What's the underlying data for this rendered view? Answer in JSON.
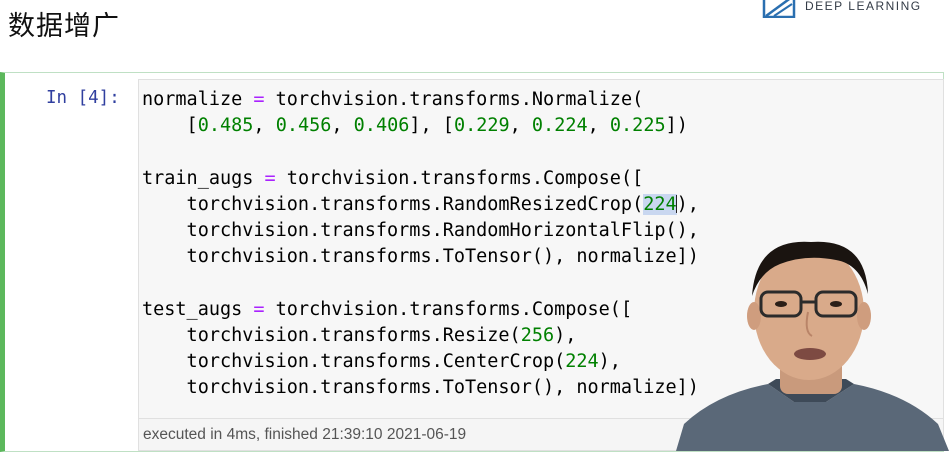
{
  "page": {
    "title": "数据增广",
    "brand": {
      "text": "DEEP LEARNING",
      "icon": "book-logo-icon"
    }
  },
  "cell": {
    "prompt": "In [4]:",
    "lines": [
      [
        {
          "t": "normalize ",
          "c": "plain"
        },
        {
          "t": "=",
          "c": "op"
        },
        {
          "t": " torchvision.transforms.Normalize(",
          "c": "plain"
        }
      ],
      [
        {
          "t": "    [",
          "c": "plain"
        },
        {
          "t": "0.485",
          "c": "num"
        },
        {
          "t": ", ",
          "c": "plain"
        },
        {
          "t": "0.456",
          "c": "num"
        },
        {
          "t": ", ",
          "c": "plain"
        },
        {
          "t": "0.406",
          "c": "num"
        },
        {
          "t": "], [",
          "c": "plain"
        },
        {
          "t": "0.229",
          "c": "num"
        },
        {
          "t": ", ",
          "c": "plain"
        },
        {
          "t": "0.224",
          "c": "num"
        },
        {
          "t": ", ",
          "c": "plain"
        },
        {
          "t": "0.225",
          "c": "num"
        },
        {
          "t": "])",
          "c": "plain"
        }
      ],
      [],
      [
        {
          "t": "train_augs ",
          "c": "plain"
        },
        {
          "t": "=",
          "c": "op"
        },
        {
          "t": " torchvision.transforms.Compose([",
          "c": "plain"
        }
      ],
      [
        {
          "t": "    torchvision.transforms.RandomResizedCrop(",
          "c": "plain"
        },
        {
          "t": "224",
          "c": "num",
          "selected": true
        },
        {
          "t": "),",
          "c": "plain"
        }
      ],
      [
        {
          "t": "    torchvision.transforms.RandomHorizontalFlip(),",
          "c": "plain"
        }
      ],
      [
        {
          "t": "    torchvision.transforms.ToTensor(), normalize])",
          "c": "plain"
        }
      ],
      [],
      [
        {
          "t": "test_augs ",
          "c": "plain"
        },
        {
          "t": "=",
          "c": "op"
        },
        {
          "t": " torchvision.transforms.Compose([",
          "c": "plain"
        }
      ],
      [
        {
          "t": "    torchvision.transforms.Resize(",
          "c": "plain"
        },
        {
          "t": "256",
          "c": "num"
        },
        {
          "t": "),",
          "c": "plain"
        }
      ],
      [
        {
          "t": "    torchvision.transforms.CenterCrop(",
          "c": "plain"
        },
        {
          "t": "224",
          "c": "num"
        },
        {
          "t": "),",
          "c": "plain"
        }
      ],
      [
        {
          "t": "    torchvision.transforms.ToTensor(), normalize])",
          "c": "plain"
        }
      ]
    ],
    "execution_info": "executed in 4ms, finished 21:39:10 2021-06-19"
  },
  "colors": {
    "operator": "#aa22ff",
    "number": "#008000",
    "prompt": "#303f9f",
    "cell_border_active": "#5cb85c"
  }
}
